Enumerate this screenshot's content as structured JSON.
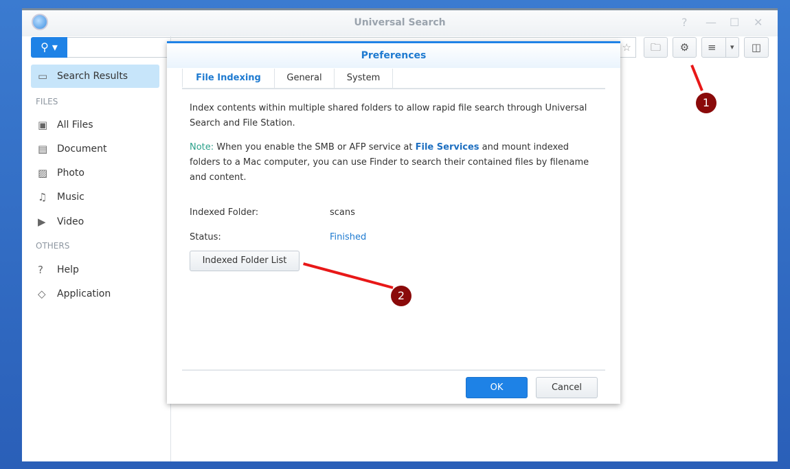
{
  "window": {
    "title": "Universal Search",
    "help": "?",
    "minimize": "—",
    "maximize": "☐",
    "close": "✕"
  },
  "toolbar": {
    "search_placeholder": "",
    "search_icon": "⚲ ▾",
    "favorite_icon": "☆",
    "folder_fav_icon": "🗀",
    "settings_icon": "⚙",
    "view_icon": "≡",
    "view_dropdown": "▾",
    "panel_icon": "◫"
  },
  "sidebar": {
    "search_results": "Search Results",
    "files_header": "FILES",
    "files": [
      {
        "label": "All Files",
        "icon": "▣"
      },
      {
        "label": "Document",
        "icon": "▤"
      },
      {
        "label": "Photo",
        "icon": "▨"
      },
      {
        "label": "Music",
        "icon": "♫"
      },
      {
        "label": "Video",
        "icon": "▶"
      }
    ],
    "others_header": "OTHERS",
    "others": [
      {
        "label": "Help",
        "icon": "?"
      },
      {
        "label": "Application",
        "icon": "◇"
      }
    ]
  },
  "dialog": {
    "title": "Preferences",
    "tabs": [
      "File Indexing",
      "General",
      "System"
    ],
    "description": "Index contents within multiple shared folders to allow rapid file search through Universal Search and File Station.",
    "note_label": "Note:",
    "note_a": " When you enable the SMB or AFP service at ",
    "note_link": "File Services",
    "note_b": " and mount indexed folders to a Mac computer, you can use Finder to search their contained files by filename and content.",
    "indexed_folder_label": "Indexed Folder:",
    "indexed_folder_value": "scans",
    "status_label": "Status:",
    "status_value": "Finished",
    "folder_list_button": "Indexed Folder List",
    "ok": "OK",
    "cancel": "Cancel"
  },
  "annotations": [
    "1",
    "2"
  ]
}
